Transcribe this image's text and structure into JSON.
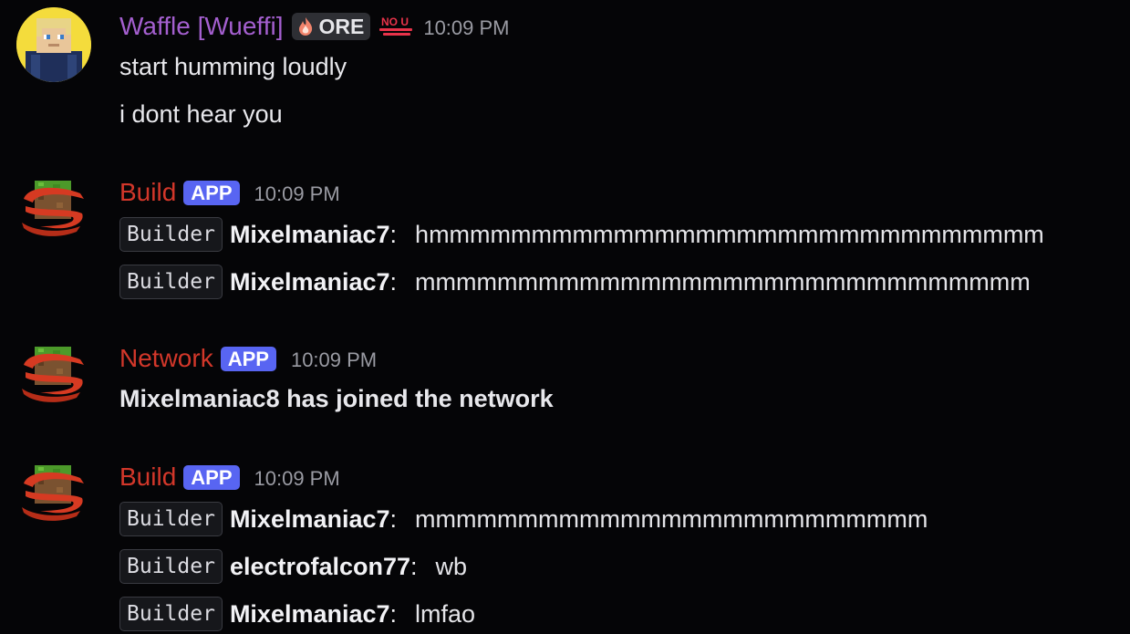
{
  "colors": {
    "background": "#050507",
    "waffle_name": "#a45fcf",
    "bot_name": "#d2372a",
    "app_badge": "#5865f2",
    "timestamp": "#9a9ba3"
  },
  "messages": [
    {
      "author": "Waffle [Wueffi]",
      "avatar_icon": "minecraft-skin-avatar-icon",
      "role_tag": {
        "icon": "flame-icon",
        "label": "ORE"
      },
      "extra_icon": "nou-emoji-icon",
      "timestamp": "10:09 PM",
      "lines": [
        "start humming loudly",
        "i dont hear you"
      ]
    },
    {
      "author": "Build",
      "avatar_icon": "server-grass-block-icon",
      "badge": "APP",
      "timestamp": "10:09 PM",
      "lines": [
        {
          "tag": "Builder",
          "player": "Mixelmaniac7",
          "colon": ":",
          "text": "hmmmmmmmmmmmmmmmmmmmmmmmmmmmmmm"
        },
        {
          "tag": "Builder",
          "player": "Mixelmaniac7",
          "colon": ":",
          "text": "mmmmmmmmmmmmmmmmmmmmmmmmmmmmmm"
        }
      ]
    },
    {
      "author": "Network",
      "avatar_icon": "server-grass-block-icon",
      "badge": "APP",
      "timestamp": "10:09 PM",
      "lines": [
        "Mixelmaniac8 has joined the network"
      ]
    },
    {
      "author": "Build",
      "avatar_icon": "server-grass-block-icon",
      "badge": "APP",
      "timestamp": "10:09 PM",
      "lines": [
        {
          "tag": "Builder",
          "player": "Mixelmaniac7",
          "colon": ":",
          "text": "mmmmmmmmmmmmmmmmmmmmmmmmm"
        },
        {
          "tag": "Builder",
          "player": "electrofalcon77",
          "colon": ":",
          "text": "wb"
        },
        {
          "tag": "Builder",
          "player": "Mixelmaniac7",
          "colon": ":",
          "text": "lmfao"
        }
      ]
    }
  ]
}
